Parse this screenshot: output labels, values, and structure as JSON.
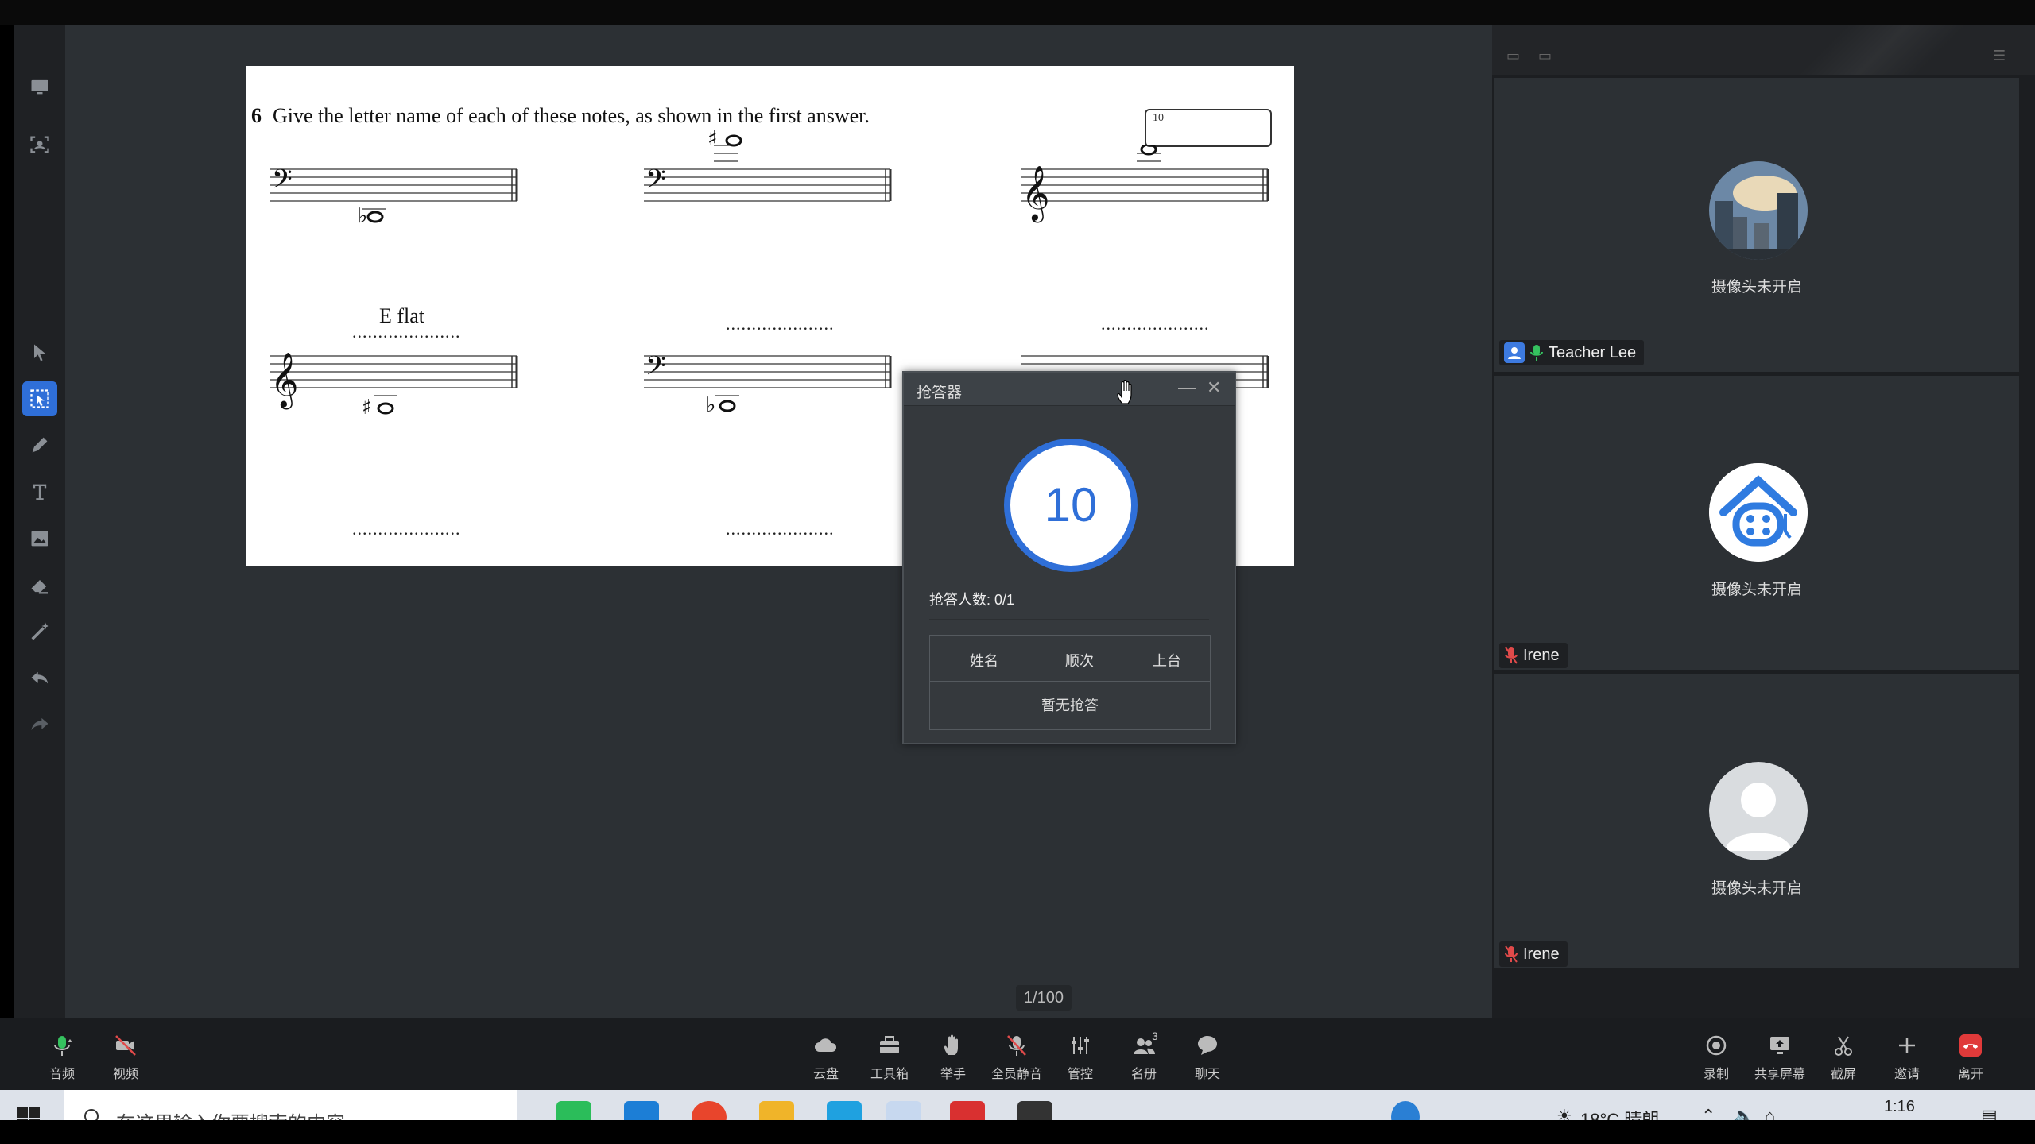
{
  "topbar": {
    "title": ""
  },
  "sheet": {
    "question_number": "6",
    "question_text": "Give the letter name of each of these notes, as shown in the first answer.",
    "score_box": "10",
    "example_answer": "E flat",
    "answer_dots": ".....................",
    "example_dots": "....................."
  },
  "board": {
    "page_indicator": "1/100"
  },
  "responder": {
    "title": "抢答器",
    "timer_value": "10",
    "count_label": "抢答人数: 0/1",
    "columns": [
      "姓名",
      "顺次",
      "上台"
    ],
    "empty_text": "暂无抢答"
  },
  "participants": [
    {
      "name": "Teacher Lee",
      "status": "摄像头未开启",
      "avatar_icon": "city-photo-avatar",
      "mic": "on"
    },
    {
      "name": "Irene",
      "status": "摄像头未开启",
      "avatar_icon": "classroom-logo-avatar",
      "mic": "muted"
    },
    {
      "name": "Irene",
      "status": "摄像头未开启",
      "avatar_icon": "default-user-avatar",
      "mic": "muted"
    }
  ],
  "controls_left": [
    {
      "label": "音频",
      "icon": "mic-icon"
    },
    {
      "label": "视频",
      "icon": "camera-off-icon"
    }
  ],
  "controls_center": [
    {
      "label": "云盘",
      "icon": "cloud-icon"
    },
    {
      "label": "工具箱",
      "icon": "toolbox-icon"
    },
    {
      "label": "举手",
      "icon": "raise-hand-icon"
    },
    {
      "label": "全员静音",
      "icon": "mute-all-icon"
    },
    {
      "label": "管控",
      "icon": "sliders-icon"
    },
    {
      "label": "名册",
      "icon": "roster-icon",
      "badge": "3"
    },
    {
      "label": "聊天",
      "icon": "chat-icon"
    }
  ],
  "controls_right": [
    {
      "label": "录制",
      "icon": "record-icon"
    },
    {
      "label": "共享屏幕",
      "icon": "share-screen-icon"
    },
    {
      "label": "截屏",
      "icon": "screenshot-icon"
    },
    {
      "label": "邀请",
      "icon": "invite-icon"
    },
    {
      "label": "离开",
      "icon": "leave-icon"
    }
  ],
  "taskbar": {
    "search_placeholder": "在这里输入你要搜索的内容",
    "weather": "18°C 晴朗",
    "time": "1:16"
  },
  "colors": {
    "accent": "#2f6fd8",
    "board": "#2c3034",
    "leave": "#e03a3a"
  }
}
